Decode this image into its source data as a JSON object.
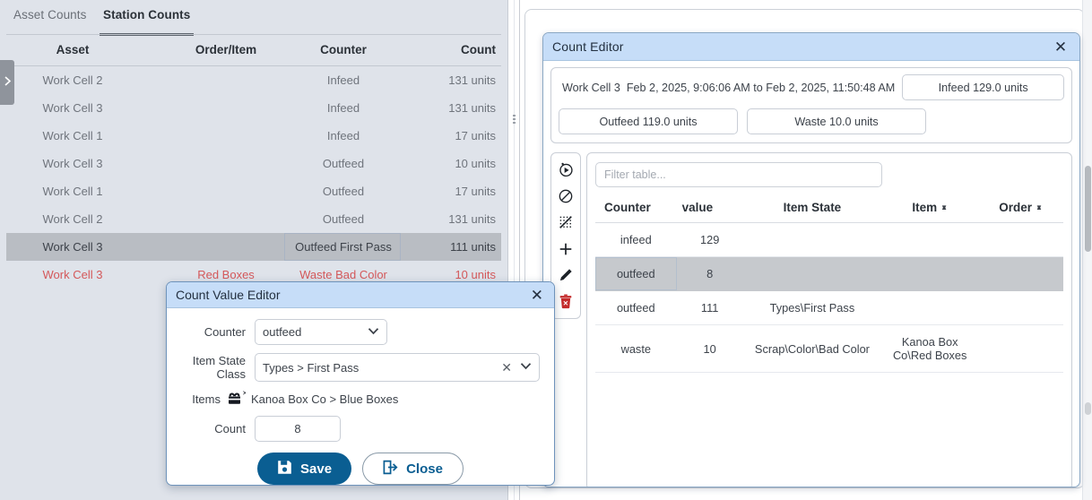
{
  "left_panel": {
    "tabs": [
      {
        "label": "Asset Counts",
        "active": false
      },
      {
        "label": "Station Counts",
        "active": true
      }
    ],
    "collapse_handle_icon": "chevron-right-icon",
    "table": {
      "columns": [
        "Asset",
        "Order/Item",
        "Counter",
        "Count"
      ],
      "rows": [
        {
          "asset": "Work Cell 2",
          "order": "",
          "counter": "Infeed",
          "count": "131 units",
          "state": "normal"
        },
        {
          "asset": "Work Cell 3",
          "order": "",
          "counter": "Infeed",
          "count": "131 units",
          "state": "normal"
        },
        {
          "asset": "Work Cell 1",
          "order": "",
          "counter": "Infeed",
          "count": "17 units",
          "state": "normal"
        },
        {
          "asset": "Work Cell 3",
          "order": "",
          "counter": "Outfeed",
          "count": "10 units",
          "state": "normal"
        },
        {
          "asset": "Work Cell 1",
          "order": "",
          "counter": "Outfeed",
          "count": "17 units",
          "state": "normal"
        },
        {
          "asset": "Work Cell 2",
          "order": "",
          "counter": "Outfeed",
          "count": "131 units",
          "state": "normal"
        },
        {
          "asset": "Work Cell 3",
          "order": "",
          "counter": "Outfeed First Pass",
          "count": "111 units",
          "state": "selected"
        },
        {
          "asset": "Work Cell 3",
          "order": "Red Boxes",
          "counter": "Waste Bad Color",
          "count": "10 units",
          "state": "error"
        }
      ]
    }
  },
  "count_editor": {
    "title": "Count Editor",
    "close_icon": "close-icon",
    "summary": {
      "asset": "Work Cell 3",
      "range": "Feb 2, 2025, 9:06:06 AM  to  Feb 2, 2025, 11:50:48 AM",
      "infeed": "Infeed 129.0 units",
      "outfeed": "Outfeed 119.0 units",
      "waste": "Waste 10.0 units"
    },
    "toolbar": [
      {
        "icon": "play-circle-icon",
        "name": "run-icon"
      },
      {
        "icon": "ban-icon",
        "name": "block-icon"
      },
      {
        "icon": "clear-selection-icon",
        "name": "clear-selection-icon"
      },
      {
        "icon": "plus-icon",
        "name": "add-icon"
      },
      {
        "icon": "pencil-icon",
        "name": "edit-icon"
      },
      {
        "icon": "trash-x-icon",
        "name": "delete-icon"
      }
    ],
    "filter": {
      "value": "",
      "placeholder": "Filter table..."
    },
    "table": {
      "columns": [
        {
          "label": "Counter",
          "sortable": false
        },
        {
          "label": "value",
          "sortable": false
        },
        {
          "label": "Item State",
          "sortable": false
        },
        {
          "label": "Item",
          "sortable": true
        },
        {
          "label": "Order",
          "sortable": true
        }
      ],
      "rows": [
        {
          "counter": "infeed",
          "value": "129",
          "item_state": "",
          "item": "",
          "order": "",
          "state": "normal"
        },
        {
          "counter": "outfeed",
          "value": "8",
          "item_state": "",
          "item": "",
          "order": "",
          "state": "selected"
        },
        {
          "counter": "outfeed",
          "value": "111",
          "item_state": "Types\\First Pass",
          "item": "",
          "order": "",
          "state": "normal"
        },
        {
          "counter": "waste",
          "value": "10",
          "item_state": "Scrap\\Color\\Bad Color",
          "item": "Kanoa Box Co\\Red Boxes",
          "order": "",
          "state": "normal"
        }
      ]
    }
  },
  "count_value_editor": {
    "title": "Count Value Editor",
    "close_icon": "close-icon",
    "fields": {
      "counter_label": "Counter",
      "counter_value": "outfeed",
      "item_state_label": "Item State Class",
      "item_state_value": "Types > First Pass",
      "items_label": "Items",
      "items_icon": "items-remove-icon",
      "items_value": "Kanoa Box Co > Blue Boxes",
      "count_label": "Count",
      "count_value": "8"
    },
    "buttons": {
      "save": "Save",
      "save_icon": "save-disk-icon",
      "close": "Close",
      "close_icon": "exit-arrow-icon"
    }
  },
  "colors": {
    "dialog_title_bg": "#c6ddf8",
    "left_panel_bg": "#dfe3ea",
    "selected_row": "#b9bdc3",
    "error_text": "#d4585a",
    "primary_button": "#0a5e92"
  }
}
